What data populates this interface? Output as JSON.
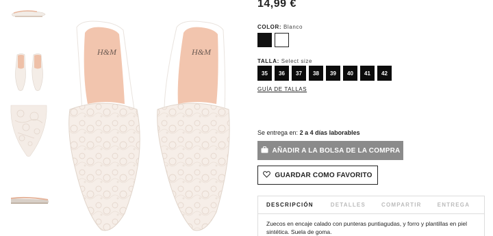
{
  "product": {
    "price": "14,99 €"
  },
  "color": {
    "label": "COLOR:",
    "value": "Blanco",
    "swatches": [
      {
        "name": "negro",
        "hex": "#111111"
      },
      {
        "name": "blanco",
        "hex": "#ffffff"
      }
    ]
  },
  "size": {
    "label": "TALLA:",
    "placeholder": "Select size",
    "options": [
      "35",
      "36",
      "37",
      "38",
      "39",
      "40",
      "41",
      "42"
    ],
    "guide_link": "GUÍA DE TALLAS"
  },
  "delivery": {
    "prefix": "Se entrega en:",
    "value": "2 a 4 días laborables"
  },
  "buttons": {
    "add_to_bag": "AÑADIR A LA BOLSA DE LA COMPRA",
    "add_to_bag_icon": "bag-icon",
    "favorite": "GUARDAR COMO FAVORITO",
    "favorite_icon": "heart-icon"
  },
  "tabs": [
    "DESCRIPCIÓN",
    "DETALLES",
    "COMPARTIR",
    "ENTREGA"
  ],
  "description": "Zuecos en encaje calado con punteras puntiagudas, y forro y plantillas en piel sintética. Suela de goma.",
  "brand_mark": "H&M",
  "colors": {
    "button_grey": "#8b8b8b",
    "size_box": "#0c0c0c",
    "lining": "#f2c5ae",
    "lace": "#f5ece5"
  }
}
